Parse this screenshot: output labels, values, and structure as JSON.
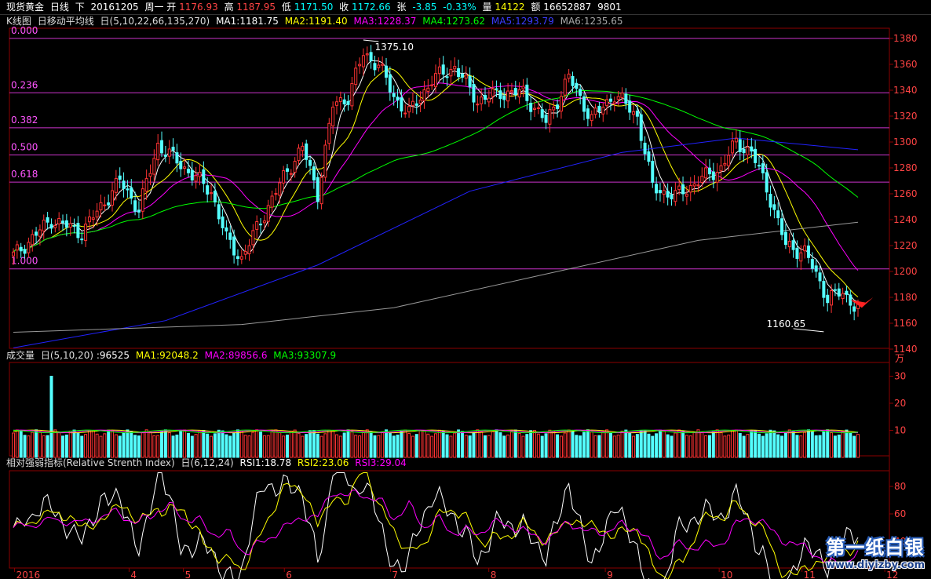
{
  "header": {
    "symbol": "现货黄金",
    "period": "日线",
    "direction": "下",
    "date": "20161205",
    "weekday": "周一",
    "open_label": "开",
    "open": "1176.93",
    "high_label": "高",
    "high": "1187.95",
    "low_label": "低",
    "low": "1171.50",
    "close_label": "收",
    "close": "1172.66",
    "change_label": "张",
    "change": "-3.85",
    "change_pct": "-0.33%",
    "volume_label": "量",
    "volume": "14122",
    "amount_label": "额",
    "amount": "16652887",
    "extra": "9801"
  },
  "kline_panel": {
    "name": "K线图",
    "ma_indicator": "日移动平均线",
    "params": "日(5,10,22,66,135,270)",
    "ma": [
      {
        "label": "MA1:1181.75",
        "color": "#ffffff"
      },
      {
        "label": "MA2:1191.40",
        "color": "#ffff00"
      },
      {
        "label": "MA3:1228.37",
        "color": "#ff00ff"
      },
      {
        "label": "MA4:1273.62",
        "color": "#00ff00"
      },
      {
        "label": "MA5:1293.79",
        "color": "#2222ff"
      },
      {
        "label": "MA6:1235.65",
        "color": "#999999"
      }
    ]
  },
  "volume_panel": {
    "name": "成交量",
    "params": "日(5,10,20)",
    "value": ":96525",
    "ma": [
      {
        "label": "MA1:92048.2",
        "color": "#ffff00"
      },
      {
        "label": "MA2:89856.6",
        "color": "#ff00ff"
      },
      {
        "label": "MA3:93307.9",
        "color": "#00ff00"
      }
    ],
    "unit": "万",
    "ticks": [
      "30",
      "20",
      "10"
    ]
  },
  "rsi_panel": {
    "name": "相对强弱指标(Relative Strenth Index)",
    "params": "日(6,12,24)",
    "values": [
      {
        "label": "RSI1:18.78",
        "color": "#ffffff"
      },
      {
        "label": "RSI2:23.06",
        "color": "#ffff00"
      },
      {
        "label": "RSI3:29.04",
        "color": "#ff00ff"
      }
    ],
    "ticks": [
      "80",
      "60",
      "40"
    ]
  },
  "fibonacci": [
    "0.000",
    "0.236",
    "0.382",
    "0.500",
    "0.618",
    "1.000"
  ],
  "annotations": {
    "high": "1375.10",
    "low": "1160.65"
  },
  "watermark": {
    "title": "第一纸白银",
    "url": "www.diyizby.com"
  },
  "chart_data": {
    "type": "candlestick",
    "x_axis_labels": [
      "2016",
      "4",
      "5",
      "6",
      "7",
      "8",
      "9",
      "10",
      "11",
      "12"
    ],
    "price_axis": {
      "ylim": [
        1140,
        1390
      ],
      "ticks": [
        "1380",
        "1360",
        "1340",
        "1320",
        "1300",
        "1280",
        "1260",
        "1240",
        "1220",
        "1200",
        "1180",
        "1160",
        "1140"
      ]
    },
    "fib_levels": [
      {
        "ratio": "0.000",
        "price": 1380
      },
      {
        "ratio": "0.236",
        "price": 1338
      },
      {
        "ratio": "0.382",
        "price": 1311
      },
      {
        "ratio": "0.500",
        "price": 1290
      },
      {
        "ratio": "0.618",
        "price": 1269
      },
      {
        "ratio": "1.000",
        "price": 1202
      }
    ],
    "close_waypoints": [
      [
        0,
        1212
      ],
      [
        10,
        1240
      ],
      [
        18,
        1230
      ],
      [
        28,
        1270
      ],
      [
        33,
        1248
      ],
      [
        38,
        1298
      ],
      [
        45,
        1280
      ],
      [
        52,
        1262
      ],
      [
        56,
        1225
      ],
      [
        60,
        1210
      ],
      [
        66,
        1245
      ],
      [
        72,
        1278
      ],
      [
        76,
        1296
      ],
      [
        80,
        1260
      ],
      [
        84,
        1328
      ],
      [
        88,
        1335
      ],
      [
        92,
        1368
      ],
      [
        96,
        1360
      ],
      [
        100,
        1335
      ],
      [
        104,
        1322
      ],
      [
        110,
        1348
      ],
      [
        116,
        1358
      ],
      [
        122,
        1332
      ],
      [
        128,
        1338
      ],
      [
        134,
        1338
      ],
      [
        140,
        1315
      ],
      [
        146,
        1350
      ],
      [
        152,
        1318
      ],
      [
        158,
        1337
      ],
      [
        164,
        1320
      ],
      [
        168,
        1265
      ],
      [
        174,
        1258
      ],
      [
        180,
        1270
      ],
      [
        186,
        1280
      ],
      [
        190,
        1300
      ],
      [
        194,
        1292
      ],
      [
        198,
        1265
      ],
      [
        203,
        1220
      ],
      [
        208,
        1215
      ],
      [
        214,
        1180
      ],
      [
        218,
        1183
      ],
      [
        222,
        1172
      ]
    ],
    "ma_lines": [
      {
        "name": "MA1",
        "color": "#ffffff",
        "lag": 2
      },
      {
        "name": "MA2",
        "color": "#ffff00",
        "lag": 5
      },
      {
        "name": "MA3",
        "color": "#ff00ff",
        "lag": 11
      },
      {
        "name": "MA4",
        "color": "#00ff00",
        "lag": 33
      }
    ],
    "long_ma": [
      {
        "name": "MA5",
        "color": "#2222ff",
        "points": [
          [
            0,
            1141
          ],
          [
            40,
            1162
          ],
          [
            80,
            1205
          ],
          [
            120,
            1262
          ],
          [
            160,
            1292
          ],
          [
            190,
            1303
          ],
          [
            222,
            1294
          ]
        ]
      },
      {
        "name": "MA6",
        "color": "#999999",
        "points": [
          [
            0,
            1153
          ],
          [
            60,
            1159
          ],
          [
            100,
            1172
          ],
          [
            140,
            1198
          ],
          [
            180,
            1224
          ],
          [
            222,
            1238
          ]
        ]
      }
    ],
    "volume_baseline_wan": 9,
    "volume_spike": {
      "index": 10,
      "value_wan": 30
    }
  }
}
